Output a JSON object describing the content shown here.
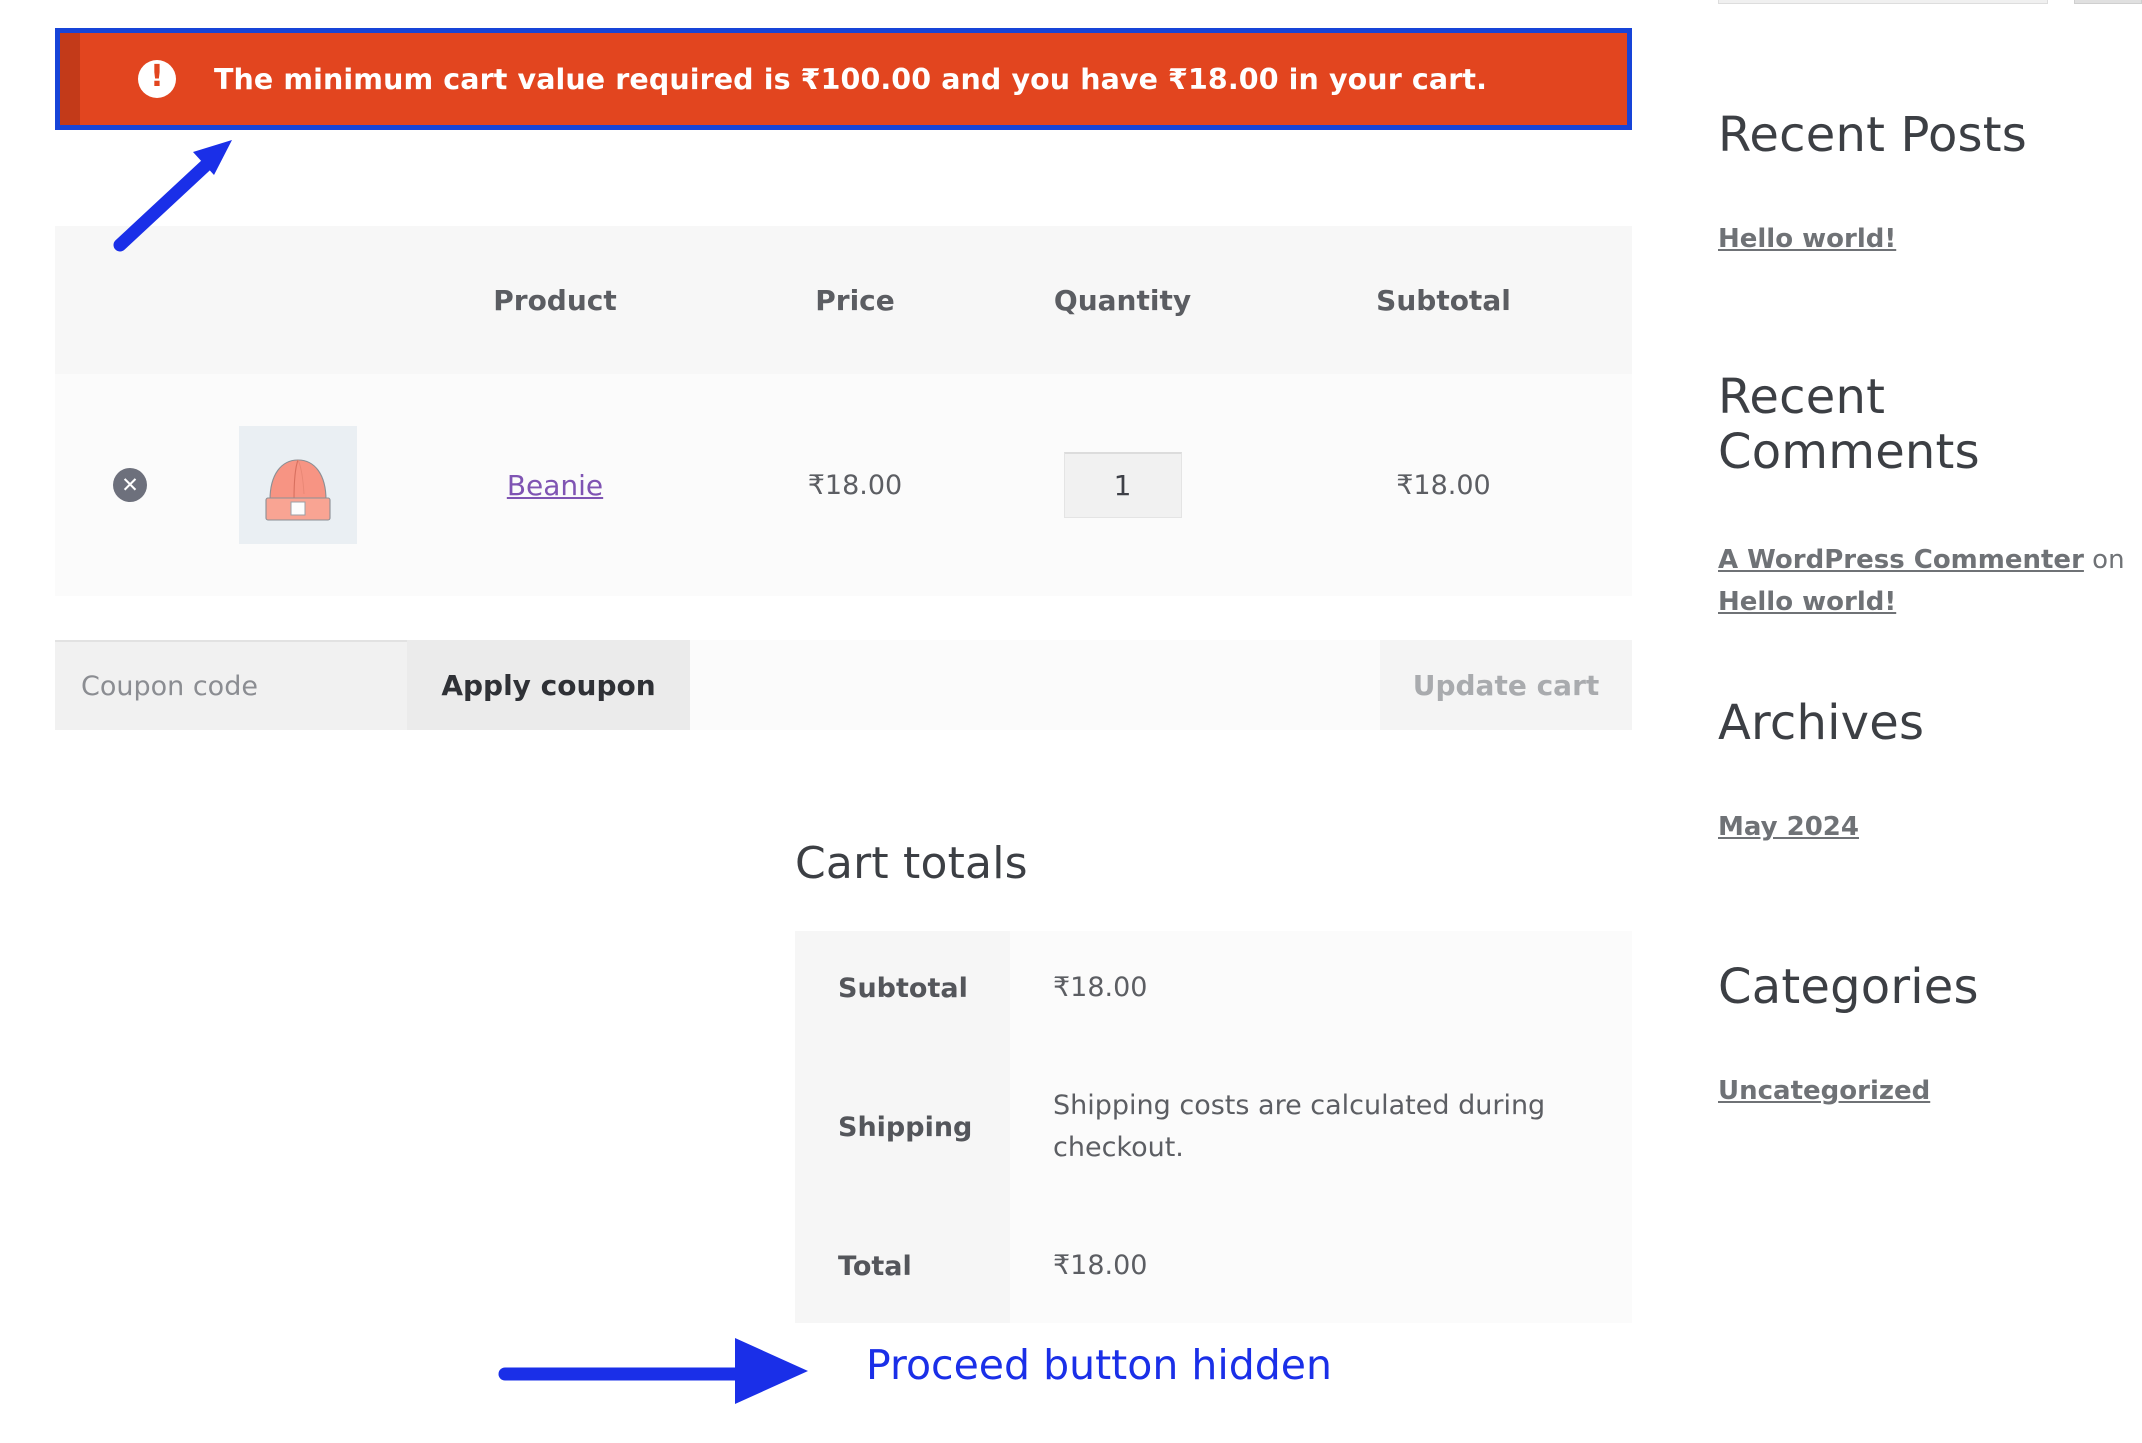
{
  "notice": {
    "icon": "exclamation-circle-icon",
    "message": "The minimum cart value required is ₹100.00 and you have ₹18.00 in your cart.",
    "background_color": "#e2451f",
    "accent_color": "#c33a19",
    "highlight_border_color": "#1744d8"
  },
  "cart_table": {
    "headers": [
      "",
      "",
      "Product",
      "Price",
      "Quantity",
      "Subtotal"
    ],
    "rows": [
      {
        "remove_label": "✕",
        "thumbnail_alt": "beanie-thumbnail",
        "product": "Beanie",
        "price": "₹18.00",
        "quantity": "1",
        "subtotal": "₹18.00"
      }
    ]
  },
  "coupon": {
    "placeholder": "Coupon code",
    "value": "",
    "apply_label": "Apply coupon",
    "update_label": "Update cart"
  },
  "totals": {
    "title": "Cart totals",
    "rows": [
      {
        "label": "Subtotal",
        "value": "₹18.00"
      },
      {
        "label": "Shipping",
        "value": "Shipping costs are calculated during checkout."
      },
      {
        "label": "Total",
        "value": "₹18.00"
      }
    ]
  },
  "sidebar": {
    "widgets": [
      {
        "title": "Recent Posts",
        "links": [
          "Hello world!"
        ]
      },
      {
        "title": "Recent Comments",
        "comment_author": "A WordPress Commenter",
        "comment_joiner": " on ",
        "comment_post": "Hello world!"
      },
      {
        "title": "Archives",
        "links": [
          "May 2024"
        ]
      },
      {
        "title": "Categories",
        "links": [
          "Uncategorized"
        ]
      }
    ]
  },
  "annotations": {
    "color": "#1a2fe8",
    "proceed_label": "Proceed button hidden"
  }
}
